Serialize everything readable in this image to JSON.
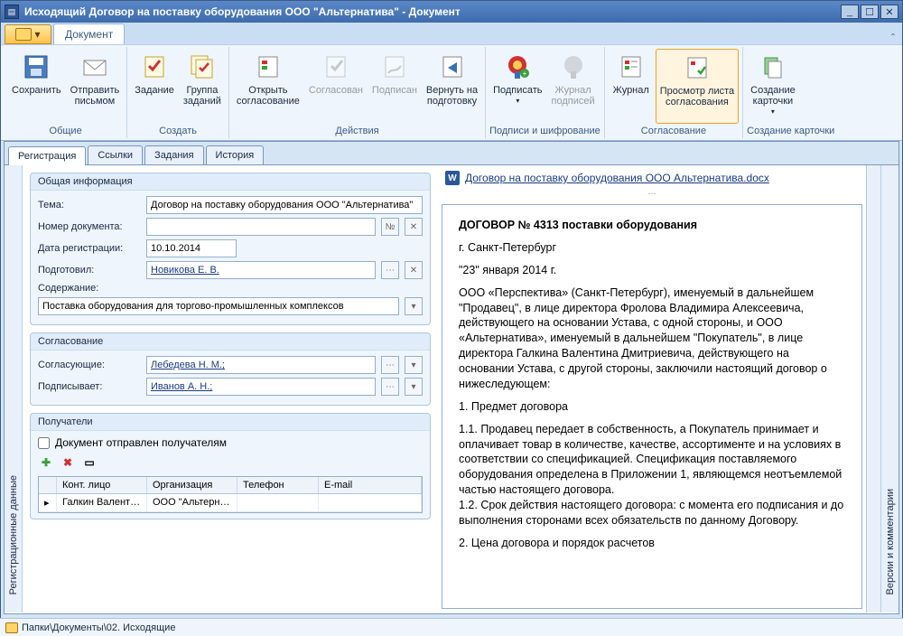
{
  "title": "Исходящий Договор на поставку оборудования ООО \"Альтернатива\" - Документ",
  "ribbon": {
    "tab": "Документ",
    "groups": {
      "g1": {
        "label": "Общие",
        "b1": "Сохранить",
        "b2": "Отправить\nписьмом"
      },
      "g2": {
        "label": "Создать",
        "b1": "Задание",
        "b2": "Группа\nзаданий"
      },
      "g3": {
        "label": "Действия",
        "b1": "Открыть\nсогласование",
        "b2": "Согласован",
        "b3": "Подписан",
        "b4": "Вернуть на\nподготовку"
      },
      "g4": {
        "label": "Подписи и шифрование",
        "b1": "Подписать",
        "b2": "Журнал\nподписей"
      },
      "g5": {
        "label": "Согласование",
        "b1": "Журнал",
        "b2": "Просмотр листа\nсогласования"
      },
      "g6": {
        "label": "Создание карточки",
        "b1": "Создание\nкарточки"
      }
    }
  },
  "tabs": {
    "t1": "Регистрация",
    "t2": "Ссылки",
    "t3": "Задания",
    "t4": "История"
  },
  "sideLeft": "Регистрационные данные",
  "sideRight": "Версии и комментарии",
  "section1": {
    "title": "Общая информация",
    "theme_l": "Тема:",
    "theme_v": "Договор на поставку оборудования ООО \"Альтернатива\"",
    "num_l": "Номер документа:",
    "num_v": "",
    "date_l": "Дата регистрации:",
    "date_v": "10.10.2014",
    "prep_l": "Подготовил:",
    "prep_v": "Новикова Е. В.",
    "cont_l": "Содержание:",
    "cont_v": "Поставка оборудования для торгово-промышленных комплексов"
  },
  "section2": {
    "title": "Согласование",
    "appr_l": "Согласующие:",
    "appr_v": "Лебедева Н. М.;",
    "sign_l": "Подписывает:",
    "sign_v": "Иванов А. Н.;"
  },
  "section3": {
    "title": "Получатели",
    "sent": "Документ отправлен получателям",
    "cols": {
      "c1": "Конт. лицо",
      "c2": "Организация",
      "c3": "Телефон",
      "c4": "E-mail"
    },
    "row": {
      "c1": "Галкин Валенти…",
      "c2": "ООО \"Альтерна…",
      "c3": "",
      "c4": ""
    }
  },
  "doc": {
    "name": "Договор на поставку оборудования ООО Альтернатива.docx",
    "h": "ДОГОВОР № 4313 поставки оборудования",
    "p1": "г. Санкт-Петербург",
    "p2": "\"23\"  января 2014 г.",
    "p3": "ООО «Перспектива» (Санкт-Петербург), именуемый в дальнейшем \"Продавец\", в лице директора Фролова Владимира Алексеевича, действующего на основании Устава, с одной стороны, и ООО «Альтернатива», именуемый в дальнейшем \"Покупатель\", в лице директора  Галкина Валентина Дмитриевича, действующего на основании Устава, с другой стороны, заключили настоящий договор о нижеследующем:",
    "p4": "1. Предмет договора",
    "p5": "1.1. Продавец передает в собственность, а Покупатель принимает и оплачивает товар в количестве, качестве, ассортименте и на условиях в соответствии со спецификацией. Спецификация поставляемого оборудования определена в Приложении 1, являющемся неотъемлемой частью настоящего договора.",
    "p6": "1.2. Срок действия настоящего договора: с момента его подписания и до выполнения сторонами всех обязательств по данному Договору.",
    "p7": "2. Цена договора и порядок расчетов"
  },
  "footer": "Папки\\Документы\\02. Исходящие"
}
